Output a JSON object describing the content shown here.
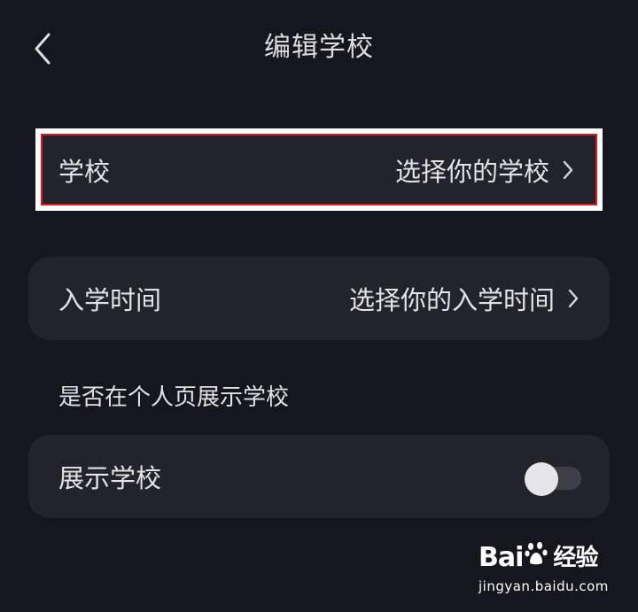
{
  "header": {
    "title": "编辑学校",
    "back_icon": "chevron-left-icon"
  },
  "school_row": {
    "label": "学校",
    "value": "选择你的学校",
    "chevron_icon": "chevron-right-icon"
  },
  "enrollment_row": {
    "label": "入学时间",
    "value": "选择你的入学时间",
    "chevron_icon": "chevron-right-icon"
  },
  "display_section": {
    "title": "是否在个人页展示学校",
    "toggle_label": "展示学校",
    "toggle_on": false
  },
  "highlight": {
    "outer_color": "#ffffff",
    "inner_color": "#e3161c"
  },
  "watermark": {
    "brand_left": "Bai",
    "brand_right": "经验",
    "paw_icon": "paw-icon",
    "url": "jingyan.baidu.com"
  },
  "colors": {
    "background": "#16161e",
    "card": "#23232c",
    "text": "#e2e2e8"
  }
}
